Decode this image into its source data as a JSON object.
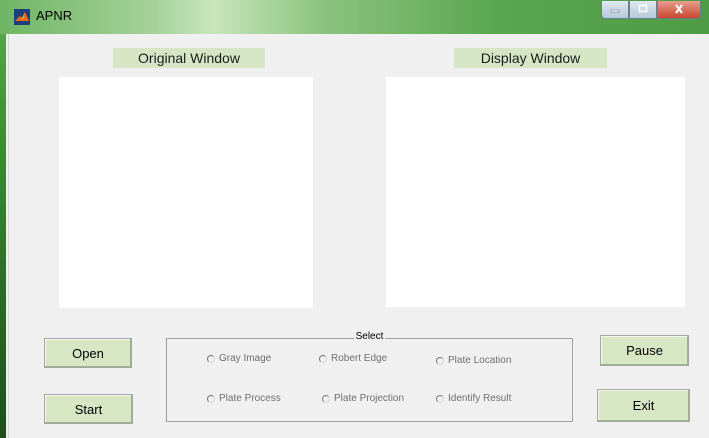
{
  "window": {
    "title": "APNR"
  },
  "panels": {
    "original_label": "Original Window",
    "display_label": "Display Window"
  },
  "buttons": {
    "open": "Open",
    "start": "Start",
    "pause": "Pause",
    "exit": "Exit"
  },
  "select_group": {
    "title": "Select",
    "options": [
      "Gray Image",
      "Robert Edge",
      "Plate Location",
      "Plate Process",
      "Plate Projection",
      "Identify Result"
    ]
  },
  "colors": {
    "titlebar_green": "#5aa650",
    "button_face": "#d7e7c3",
    "label_bg": "#d6e6c4",
    "client_bg": "#f0f0f0"
  },
  "icons": [
    "matlab-figure-icon",
    "minimize-icon",
    "maximize-icon",
    "close-icon"
  ]
}
